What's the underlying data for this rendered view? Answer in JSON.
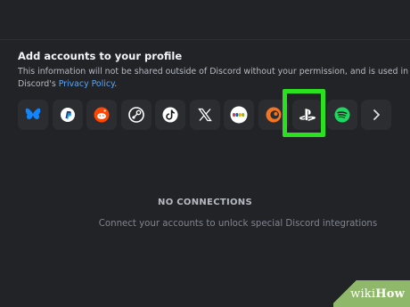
{
  "section": {
    "heading": "Add accounts to your profile",
    "desc_line1": "This information will not be shared outside of Discord without your permission, and is used in accordance with",
    "desc_line2_prefix": "Discord's ",
    "privacy_link": "Privacy Policy",
    "desc_line2_suffix": "."
  },
  "connections": [
    {
      "name": "Bluesky",
      "icon": "butterfly-icon",
      "color": "#1185fe"
    },
    {
      "name": "PayPal",
      "icon": "paypal-icon",
      "color": "#253b80"
    },
    {
      "name": "Reddit",
      "icon": "reddit-icon",
      "color": "#ff4500"
    },
    {
      "name": "Steam",
      "icon": "steam-icon",
      "color": "#ffffff"
    },
    {
      "name": "TikTok",
      "icon": "tiktok-icon",
      "color": "#ffffff"
    },
    {
      "name": "X",
      "icon": "x-icon",
      "color": "#ffffff"
    },
    {
      "name": "eBay",
      "icon": "ebay-icon",
      "color": "#e53238"
    },
    {
      "name": "Crunchyroll",
      "icon": "crunchyroll-icon",
      "color": "#f47521"
    },
    {
      "name": "PlayStation Network",
      "icon": "playstation-icon",
      "color": "#ffffff"
    },
    {
      "name": "Spotify",
      "icon": "spotify-icon",
      "color": "#1ed760"
    },
    {
      "name": "More",
      "icon": "chevron-right-icon",
      "color": "#dbdee1"
    }
  ],
  "highlight_color": "#29e11f",
  "empty_state": {
    "title": "NO CONNECTIONS",
    "subtitle": "Connect your accounts to unlock special Discord integrations"
  },
  "watermark": {
    "wiki": "wiki",
    "how": "How"
  }
}
